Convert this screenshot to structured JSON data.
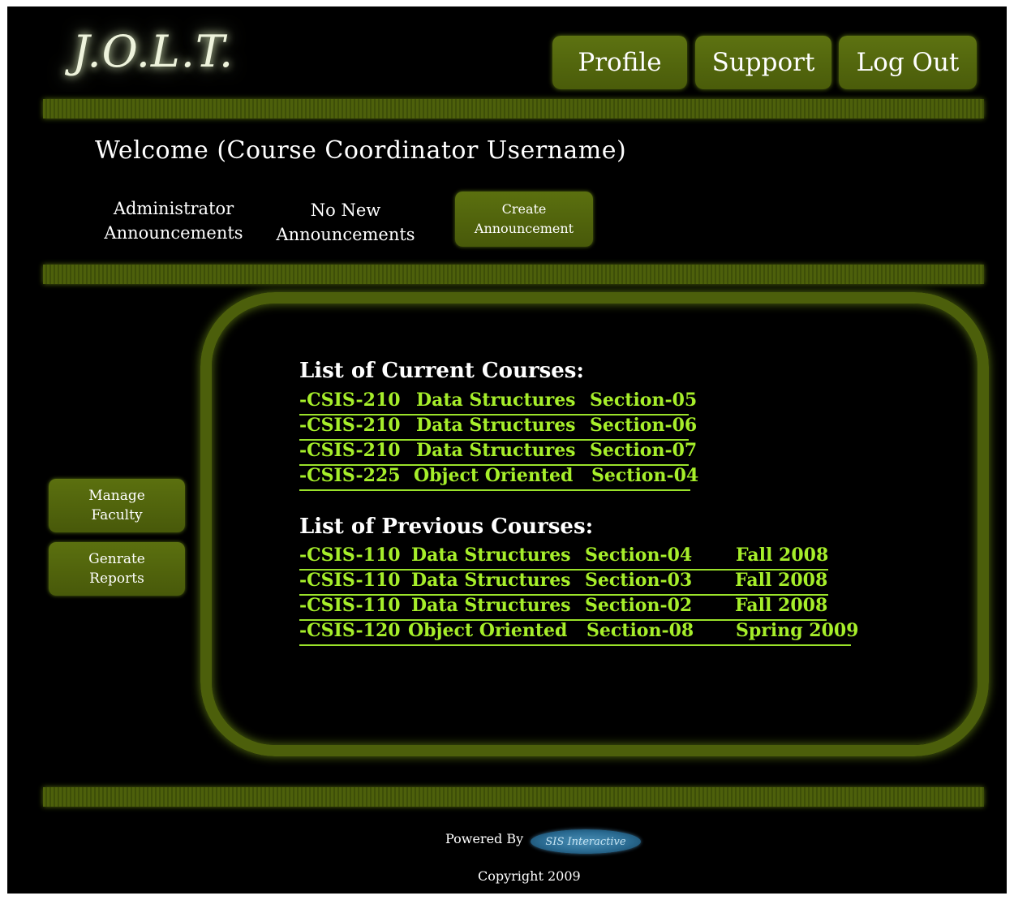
{
  "header": {
    "logo": "J.O.L.T.",
    "nav": {
      "profile": "Profile",
      "support": "Support",
      "logout": "Log Out"
    }
  },
  "welcome": "Welcome (Course Coordinator Username)",
  "announcements": {
    "admin_line1": "Administrator",
    "admin_line2": "Announcements",
    "status_line1": "No New",
    "status_line2": "Announcements",
    "create_line1": "Create",
    "create_line2": "Announcement"
  },
  "sidebar": {
    "manage_line1": "Manage",
    "manage_line2": "Faculty",
    "reports_line1": "Genrate",
    "reports_line2": "Reports"
  },
  "current_courses": {
    "title": "List of Current Courses:",
    "rows": [
      {
        "code": "-CSIS-210",
        "name": "Data Structures",
        "section": "Section-05"
      },
      {
        "code": "-CSIS-210",
        "name": "Data Structures",
        "section": "Section-06"
      },
      {
        "code": "-CSIS-210",
        "name": "Data Structures",
        "section": "Section-07"
      },
      {
        "code": "-CSIS-225",
        "name": "Object Oriented",
        "section": "Section-04"
      }
    ]
  },
  "previous_courses": {
    "title": "List of Previous Courses:",
    "rows": [
      {
        "code": "-CSIS-110",
        "name": "Data Structures",
        "section": "Section-04",
        "term": "Fall 2008"
      },
      {
        "code": "-CSIS-110",
        "name": "Data Structures",
        "section": "Section-03",
        "term": "Fall 2008"
      },
      {
        "code": "-CSIS-110",
        "name": "Data Structures",
        "section": "Section-02",
        "term": "Fall 2008"
      },
      {
        "code": "-CSIS-120",
        "name": "Object Oriented",
        "section": "Section-08",
        "term": "Spring 2009"
      }
    ]
  },
  "footer": {
    "powered_by": "Powered By",
    "sis_logo_text": "SIS Interactive",
    "copyright": "Copyright 2009"
  },
  "colors": {
    "background": "#000000",
    "accent_green": "#4c5f0b",
    "link_green": "#a6ee2a",
    "text_white": "#ffffff"
  }
}
